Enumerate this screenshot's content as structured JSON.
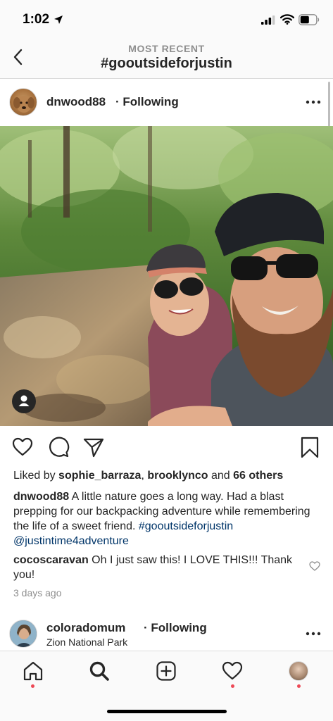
{
  "status_bar": {
    "time": "1:02"
  },
  "nav": {
    "subtitle": "MOST RECENT",
    "title": "#gooutsideforjustin"
  },
  "post": {
    "username": "dnwood88",
    "follow_state": "· Following",
    "likes": {
      "prefix": "Liked by ",
      "user1": "sophie_barraza",
      "separator": ", ",
      "user2": "brooklynco",
      "conjunction": " and ",
      "others": "66 others"
    },
    "caption": {
      "username": "dnwood88",
      "text": " A little nature goes a long way. Had a blast prepping for our backpacking adventure while remembering the life of a sweet friend. ",
      "hashtag": "#gooutsideforjustin",
      "mention": "@justintime4adventure"
    },
    "comment": {
      "username": "cocoscaravan",
      "text": " Oh I just saw this! I LOVE THIS!!! Thank you!"
    },
    "time_ago": "3 days ago"
  },
  "next_post": {
    "username": "coloradomum",
    "follow_state": "· Following",
    "location": "Zion National Park"
  },
  "icons": {
    "back": "chevron-left-icon",
    "more": "more-horizontal-icon",
    "like": "heart-outline-icon",
    "comment": "comment-bubble-icon",
    "share": "paper-plane-icon",
    "save": "bookmark-icon",
    "tag": "person-tag-icon",
    "tabs": [
      "home-icon",
      "search-icon",
      "add-post-icon",
      "activity-heart-icon",
      "profile-avatar"
    ]
  },
  "colors": {
    "notification_dot": "#ed4956",
    "link": "#003569",
    "secondary_text": "#8e8e8e"
  }
}
